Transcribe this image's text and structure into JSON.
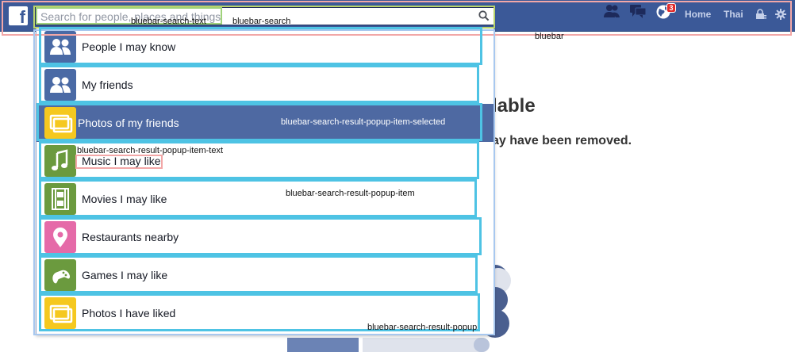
{
  "bluebar": {
    "logo": "f",
    "search_placeholder": "Search for people, places and things",
    "notification_count": "3",
    "home_label": "Home",
    "profile_label": "Thai"
  },
  "search_results": [
    {
      "label": "People I may know",
      "icon": "people-icon",
      "color": "#4a6aa5"
    },
    {
      "label": "My friends",
      "icon": "people-icon",
      "color": "#4a6aa5"
    },
    {
      "label": "Photos of my friends",
      "icon": "photos-icon",
      "color": "#f5c81f",
      "selected": true
    },
    {
      "label": "Music I may like",
      "icon": "music-note-icon",
      "color": "#6b9a3e"
    },
    {
      "label": "Movies I may like",
      "icon": "film-icon",
      "color": "#6b9a3e"
    },
    {
      "label": "Restaurants nearby",
      "icon": "location-pin-icon",
      "color": "#e56aa8"
    },
    {
      "label": "Games I may like",
      "icon": "gamepad-icon",
      "color": "#6b9a3e"
    },
    {
      "label": "Photos I have liked",
      "icon": "photos-icon",
      "color": "#f5c81f"
    }
  ],
  "page": {
    "title_partial": "lable",
    "message_partial": "ay have been removed."
  },
  "annotations": {
    "bluebar": "bluebar",
    "search": "bluebar-search",
    "search_text": "bluebar-search-text",
    "popup": "bluebar-search-result-popup",
    "popup_item": "bluebar-search-result-popup-item",
    "popup_item_text": "bluebar-search-result-popup-item-text",
    "popup_selected": "bluebar-search-result-popup-item-selected"
  },
  "colors": {
    "bluebar": "#3b5998",
    "selected_row": "#4e69a2",
    "item_outline": "#4ec3e4"
  }
}
